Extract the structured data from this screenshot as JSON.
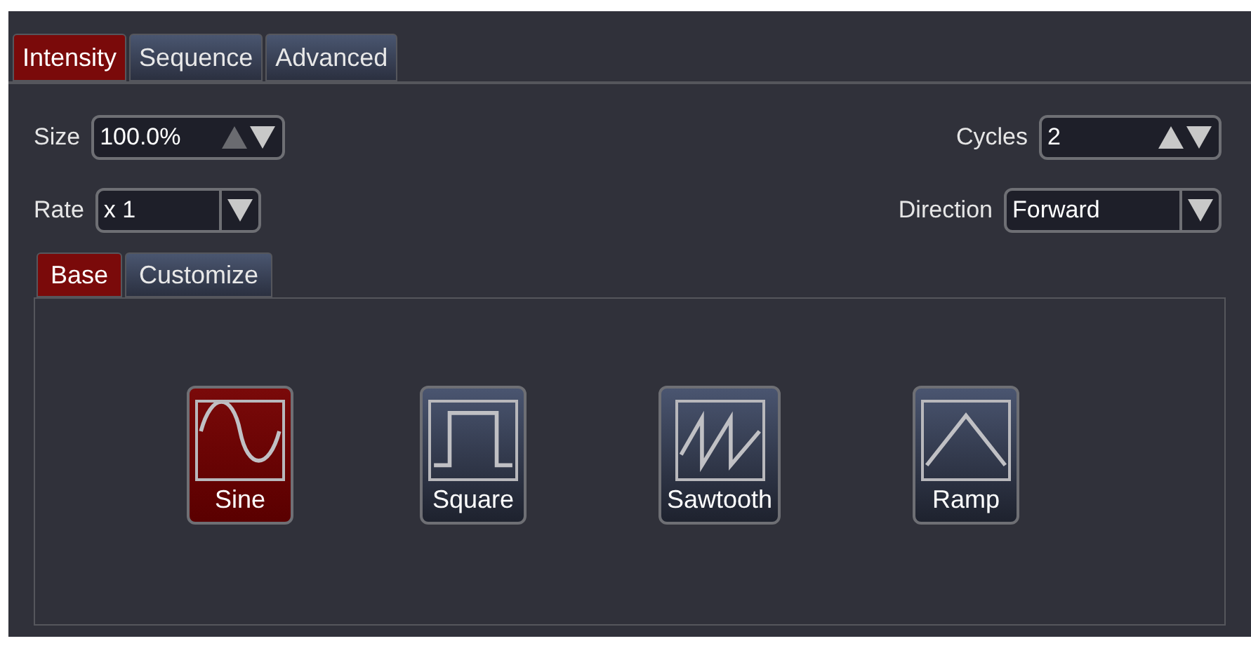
{
  "tabs": [
    {
      "label": "Intensity",
      "selected": true
    },
    {
      "label": "Sequence",
      "selected": false
    },
    {
      "label": "Advanced",
      "selected": false
    }
  ],
  "left_fields": [
    {
      "kind": "spinner",
      "label": "Size",
      "value": "100.0%",
      "up_enabled": false,
      "down_enabled": true
    },
    {
      "kind": "dropdown",
      "label": "Rate",
      "value": "x 1"
    }
  ],
  "right_fields": [
    {
      "kind": "spinner",
      "label": "Cycles",
      "value": "2",
      "up_enabled": true,
      "down_enabled": true
    },
    {
      "kind": "dropdown",
      "label": "Direction",
      "value": "Forward"
    }
  ],
  "sub_tabs": [
    {
      "label": "Base",
      "selected": true
    },
    {
      "label": "Customize",
      "selected": false
    }
  ],
  "waveforms": [
    {
      "kind": "sine",
      "label": "Sine",
      "selected": true
    },
    {
      "kind": "square",
      "label": "Square",
      "selected": false
    },
    {
      "kind": "sawtooth",
      "label": "Sawtooth",
      "selected": false
    },
    {
      "kind": "ramp",
      "label": "Ramp",
      "selected": false
    }
  ]
}
